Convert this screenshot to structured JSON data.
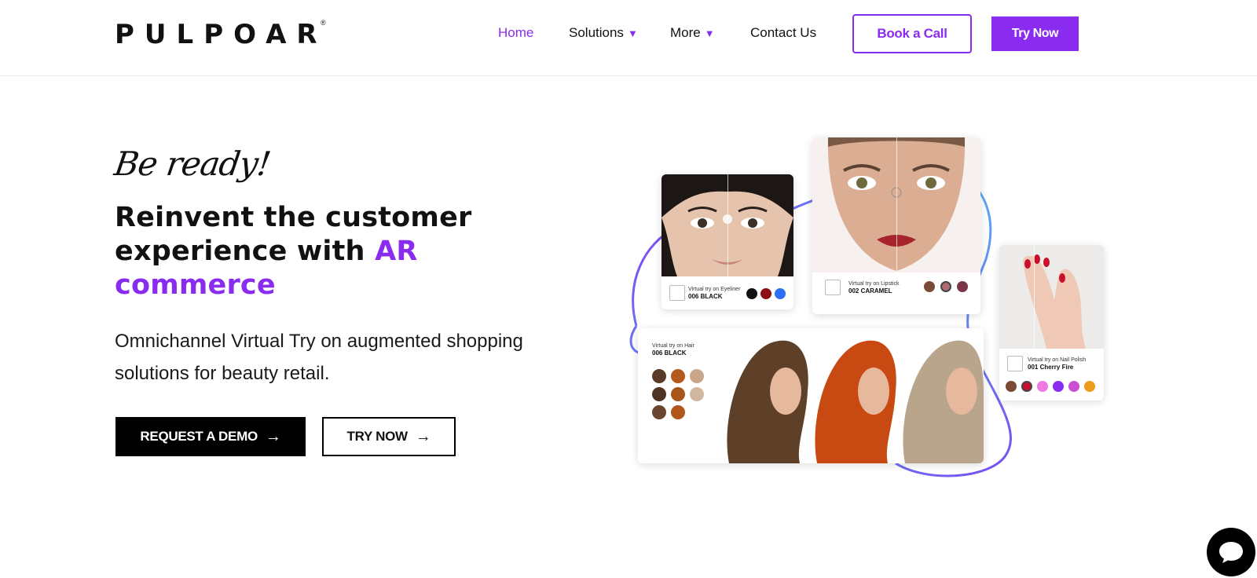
{
  "brand": {
    "logo_text": "PULPOAR",
    "reg_mark": "®"
  },
  "nav": {
    "home": "Home",
    "solutions": "Solutions",
    "more": "More",
    "contact": "Contact Us",
    "caret": "▼",
    "book_call": "Book a Call",
    "try_now": "Try Now"
  },
  "hero": {
    "tagline": "Be ready!",
    "headline_part1": "Reinvent the customer experience with ",
    "headline_highlight": "AR commerce",
    "subtext": "Omnichannel Virtual Try on augmented shopping solutions for beauty retail.",
    "cta_demo": "REQUEST A DEMO",
    "cta_try": "TRY NOW",
    "arrow": "→"
  },
  "cards": {
    "eyeliner": {
      "caption": "Virtual try on Eyeliner",
      "product": "006 BLACK"
    },
    "lipstick": {
      "caption": "Virtual try on Lipstick",
      "product": "002 CARAMEL"
    },
    "hair": {
      "caption": "Virtual try on Hair",
      "product": "006 BLACK"
    },
    "nail": {
      "caption": "Virtual try on Nail Polish",
      "product": "001 Cherry Fire"
    }
  },
  "colors": {
    "accent": "#8a2cf0",
    "black": "#000000"
  },
  "icons": {
    "chat": "chat-bubble-icon"
  }
}
